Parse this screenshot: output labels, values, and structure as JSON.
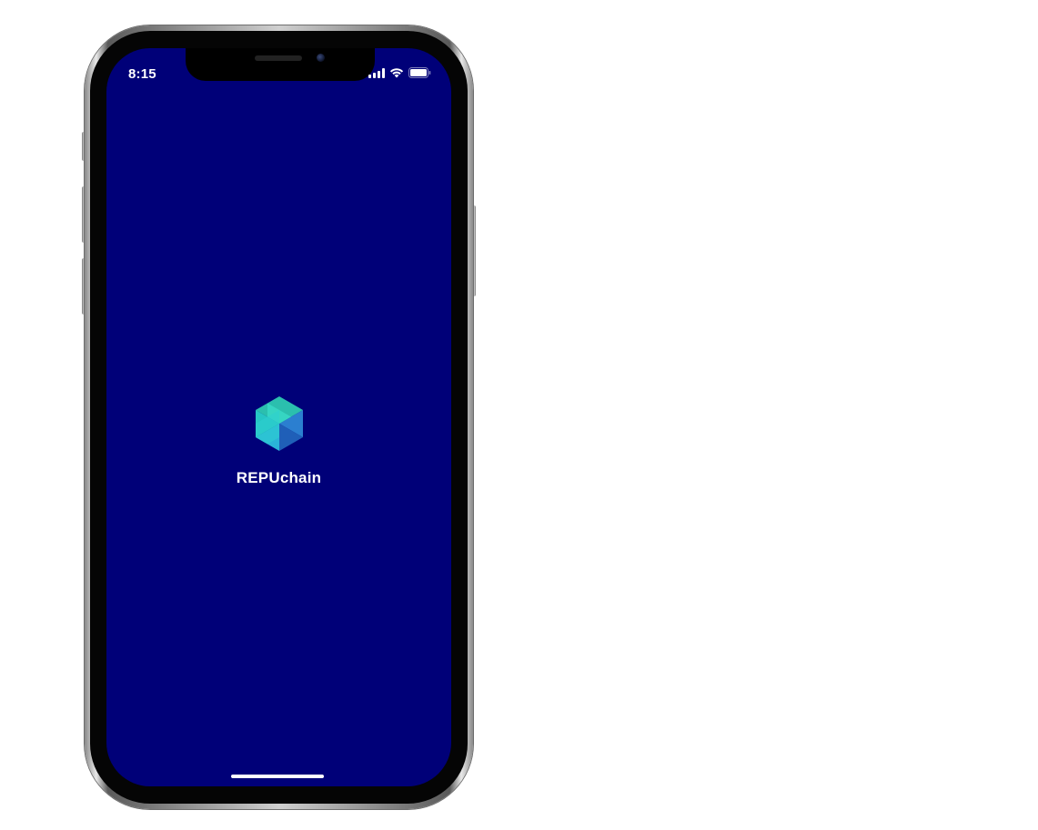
{
  "status_bar": {
    "time": "8:15",
    "signal_icon": "cellular-signal-icon",
    "wifi_icon": "wifi-icon",
    "battery_icon": "battery-icon"
  },
  "splash": {
    "brand_name": "REPUchain",
    "logo_icon": "repuchain-hexagon-logo",
    "background_color": "#000078",
    "logo_colors": [
      "#2bbfae",
      "#2ad3c8",
      "#2b7fd0",
      "#1f5fb8"
    ]
  },
  "device": {
    "model": "iphone-frame"
  }
}
